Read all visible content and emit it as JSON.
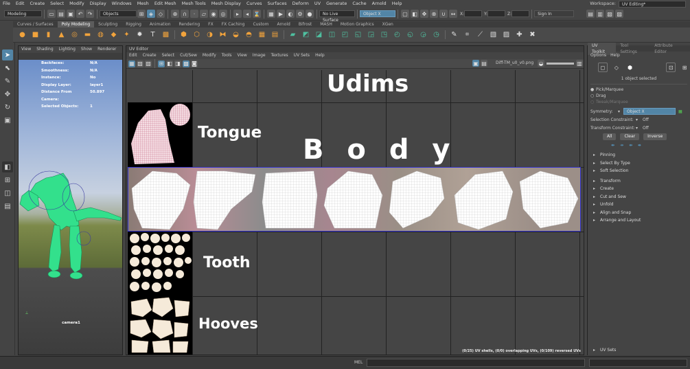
{
  "menubar": {
    "items": [
      "File",
      "Edit",
      "Create",
      "Select",
      "Modify",
      "Display",
      "Windows",
      "Mesh",
      "Edit Mesh",
      "Mesh Tools",
      "Mesh Display",
      "Curves",
      "Surfaces",
      "Deform",
      "UV",
      "Generate",
      "Cache",
      "Arnold",
      "Help"
    ],
    "workspace_label": "Workspace:",
    "workspace_value": "UV Editing*"
  },
  "statusline": {
    "mode": "Modeling",
    "select_mode": "Objects",
    "live_surface": "No Live Surface",
    "symmetry": "Object X",
    "x_label": "X:",
    "y_label": "Y:",
    "z_label": "Z:",
    "sign_in": "Sign In"
  },
  "shelf": {
    "tabs": [
      "Curves / Surfaces",
      "Poly Modeling",
      "Sculpting",
      "Rigging",
      "Animation",
      "Rendering",
      "FX",
      "FX Caching",
      "Custom",
      "Arnold",
      "Bifrost",
      "MASH",
      "Motion Graphics",
      "XGen"
    ],
    "active_tab": 1
  },
  "viewport": {
    "menu": [
      "View",
      "Shading",
      "Lighting",
      "Show",
      "Renderer"
    ],
    "hud": [
      {
        "key": "Backfaces:",
        "value": "N/A"
      },
      {
        "key": "Smoothness:",
        "value": "N/A"
      },
      {
        "key": "Instance:",
        "value": "No"
      },
      {
        "key": "Display Layer:",
        "value": "layer1"
      },
      {
        "key": "Distance From Camera:",
        "value": "50.897"
      },
      {
        "key": "Selected Objects:",
        "value": "1"
      }
    ],
    "camera_label": "camera1"
  },
  "uv_editor": {
    "title": "UV Editor",
    "menu": [
      "Edit",
      "Create",
      "Select",
      "Cut/Sew",
      "Modify",
      "Tools",
      "View",
      "Image",
      "Textures",
      "UV Sets",
      "Help"
    ],
    "texture_name": "Diff-TM_u0_v0.png",
    "status": "(0/25) UV shells, (0/0) overlapping UVs, (0/109) reversed UVs",
    "labels": {
      "udims": "Udims",
      "tongue": "Tongue",
      "body": "B o d y",
      "tooth": "Tooth",
      "hooves": "Hooves"
    }
  },
  "right_panel": {
    "tabs": [
      "UV Toolkit",
      "Tool Settings",
      "Attribute Editor"
    ],
    "menu": [
      "Options",
      "Help"
    ],
    "selection_info": "1 object selected",
    "pick_modes": [
      "Pick/Marquee",
      "Drag",
      "Tweak/Marquee"
    ],
    "symmetry_label": "Symmetry:",
    "symmetry_value": "Object X",
    "selection_constraint_label": "Selection Constraint:",
    "selection_constraint_value": "Off",
    "transform_constraint_label": "Transform Constraint:",
    "transform_constraint_value": "Off",
    "buttons": [
      "All",
      "Clear",
      "Inverse"
    ],
    "subsections": [
      "Pinning",
      "Select By Type",
      "Soft Selection"
    ],
    "sections": [
      "Transform",
      "Create",
      "Cut and Sew",
      "Unfold",
      "Align and Snap",
      "Arrange and Layout"
    ],
    "footer_section": "UV Sets"
  },
  "bottombar": {
    "mel_label": "MEL"
  },
  "colors": {
    "accent": "#5285a6",
    "body_tile_border": "#3333cc",
    "model": "#33e08c"
  }
}
